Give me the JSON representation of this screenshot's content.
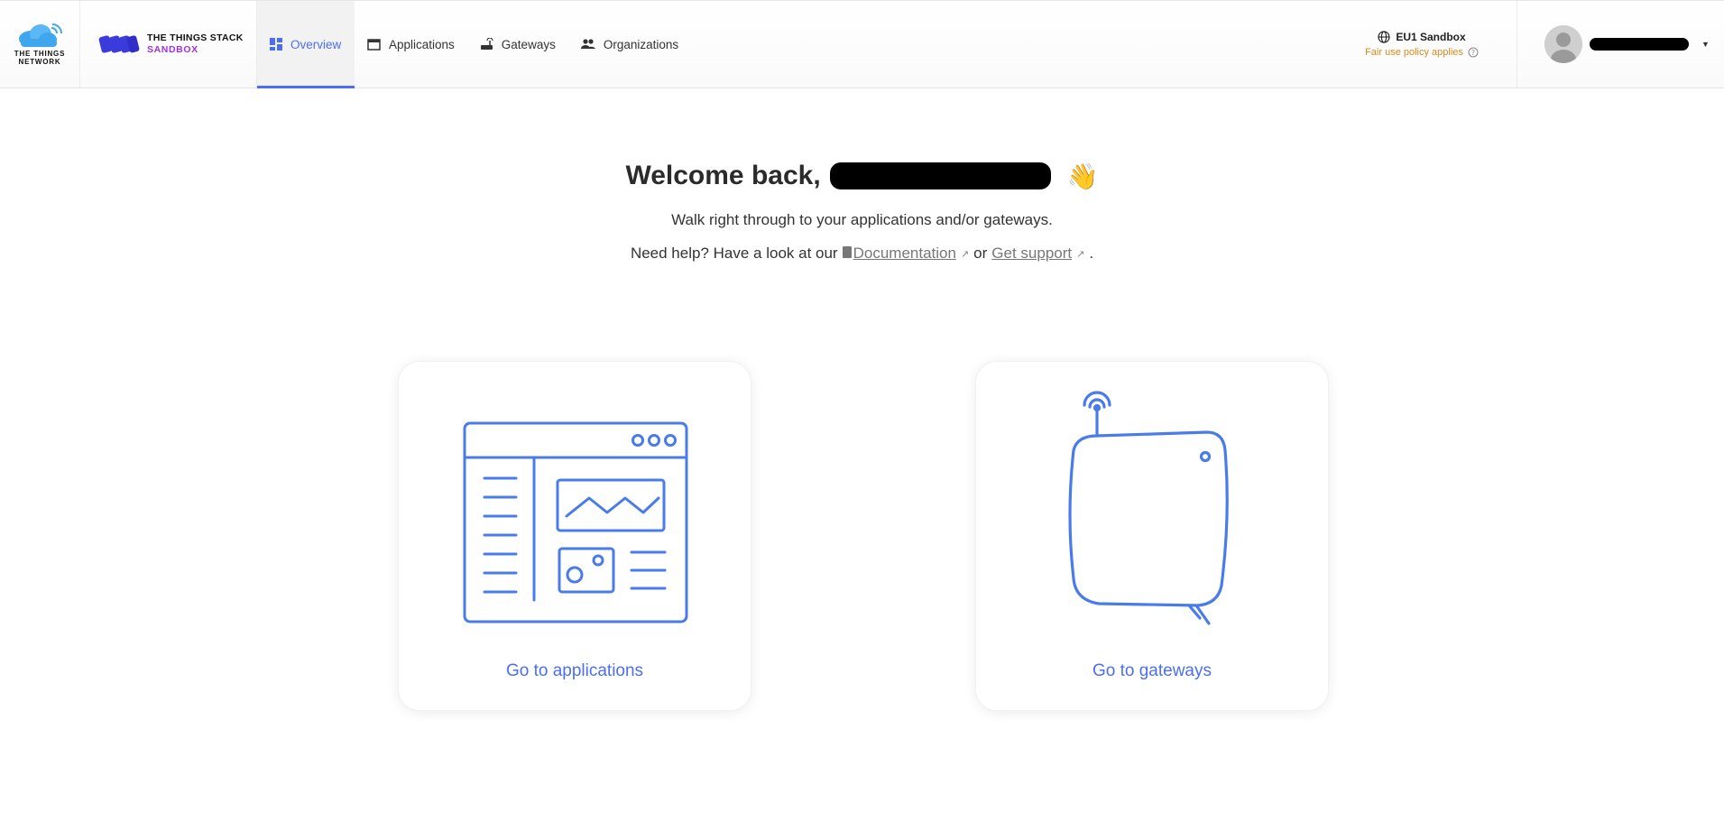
{
  "header": {
    "ttn_brand": "THE THINGS NETWORK",
    "tts_title": "THE THINGS STACK",
    "tts_sub": "SANDBOX",
    "nav": [
      {
        "label": "Overview",
        "icon": "overview-icon",
        "active": true
      },
      {
        "label": "Applications",
        "icon": "application-window-icon",
        "active": false
      },
      {
        "label": "Gateways",
        "icon": "router-icon",
        "active": false
      },
      {
        "label": "Organizations",
        "icon": "people-icon",
        "active": false
      }
    ],
    "cluster": {
      "name": "EU1 Sandbox",
      "note": "Fair use policy applies"
    },
    "user": {
      "name_redacted": true
    }
  },
  "main": {
    "welcome_prefix": "Welcome back,",
    "wave_emoji": "👋",
    "subtitle": "Walk right through to your applications and/or gateways.",
    "help_prefix": "Need help? Have a look at our",
    "doc_link": "Documentation",
    "or_text": "or",
    "support_link": "Get support",
    "period": "."
  },
  "cards": {
    "applications_label": "Go to applications",
    "gateways_label": "Go to gateways"
  },
  "colors": {
    "accent": "#4c6ef5",
    "warning": "#d98a1a",
    "brand_purple": "#a230e0",
    "illustration": "#4a7bea"
  }
}
